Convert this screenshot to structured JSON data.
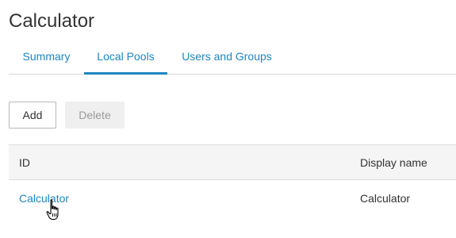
{
  "page": {
    "title": "Calculator"
  },
  "tabs": [
    {
      "label": "Summary",
      "active": false
    },
    {
      "label": "Local Pools",
      "active": true
    },
    {
      "label": "Users and Groups",
      "active": false
    }
  ],
  "toolbar": {
    "add_label": "Add",
    "delete_label": "Delete",
    "delete_enabled": false
  },
  "table": {
    "columns": [
      "ID",
      "Display name"
    ],
    "rows": [
      {
        "id": "Calculator",
        "display_name": "Calculator"
      }
    ]
  },
  "colors": {
    "accent": "#1f86c0",
    "header_bg": "#f5f5f5",
    "disabled_bg": "#efefef"
  },
  "cursor": {
    "icon": "hand-pointer-icon"
  }
}
